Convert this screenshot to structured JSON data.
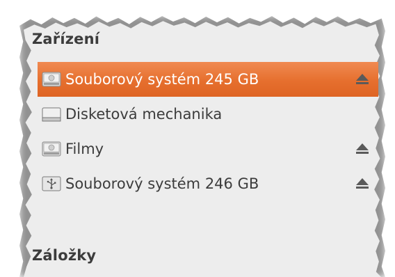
{
  "sidebar": {
    "sections": [
      {
        "heading": "Zařízení",
        "items": [
          {
            "label": "Souborový systém 245 GB",
            "icon": "harddisk-icon",
            "ejectable": true,
            "selected": true
          },
          {
            "label": "Disketová mechanika",
            "icon": "floppy-drive-icon",
            "ejectable": false,
            "selected": false
          },
          {
            "label": "Filmy",
            "icon": "harddisk-icon",
            "ejectable": true,
            "selected": false
          },
          {
            "label": "Souborový systém 246 GB",
            "icon": "usb-drive-icon",
            "ejectable": true,
            "selected": false
          }
        ]
      },
      {
        "heading": "Záložky",
        "items": []
      }
    ]
  },
  "colors": {
    "selection": "#e66f2e",
    "panel_background": "#ededed",
    "text": "#3c3c3c",
    "selected_text": "#ffffff"
  }
}
